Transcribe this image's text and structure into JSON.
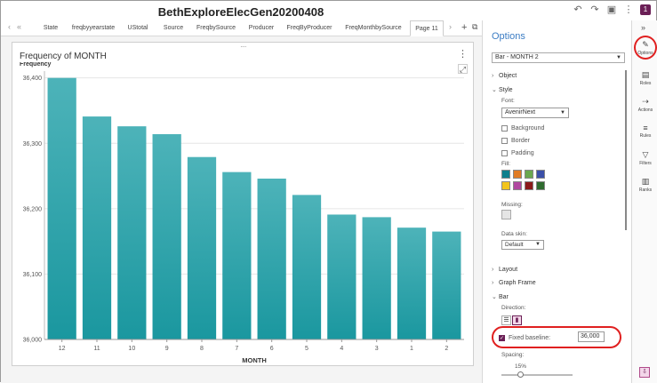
{
  "app": {
    "title": "BethExploreElecGen20200408",
    "badge": "1"
  },
  "tabs": {
    "items": [
      "State",
      "freqbyyearstate",
      "UStotal",
      "Source",
      "FreqbySource",
      "Producer",
      "FreqByProducer",
      "FreqMonthbySource",
      "Page 11"
    ],
    "active_index": 8
  },
  "chart": {
    "title": "Frequency of MONTH"
  },
  "chart_data": {
    "type": "bar",
    "title": "Frequency of MONTH",
    "xlabel": "MONTH",
    "ylabel": "Frequency",
    "categories": [
      "12",
      "11",
      "10",
      "9",
      "8",
      "7",
      "6",
      "5",
      "4",
      "3",
      "1",
      "2"
    ],
    "values": [
      36400,
      36341,
      36326,
      36314,
      36279,
      36256,
      36246,
      36221,
      36191,
      36187,
      36171,
      36165
    ],
    "ylim": [
      36000,
      36405
    ],
    "yticks": [
      36000,
      36100,
      36200,
      36300,
      36400
    ],
    "ytick_labels": [
      "36,000",
      "36,100",
      "36,200",
      "36,300",
      "36,400"
    ],
    "baseline": 36000,
    "grid": true,
    "color": "#2aa4ab"
  },
  "options": {
    "title": "Options",
    "object_select": "Bar - MONTH 2",
    "sections": {
      "object": "Object",
      "style": "Style",
      "layout": "Layout",
      "graph_frame": "Graph Frame",
      "bar": "Bar"
    },
    "font_label": "Font:",
    "font_value": "AvenirNext",
    "checks": [
      "Background",
      "Border",
      "Padding"
    ],
    "fill_label": "Fill:",
    "fill_colors": [
      "#0e7f8c",
      "#e07b24",
      "#6aa84f",
      "#3b4fa8",
      "#f2c41c",
      "#b048a0",
      "#8b1a1a",
      "#2f6b2f"
    ],
    "missing_label": "Missing:",
    "data_skin_label": "Data skin:",
    "data_skin_value": "Default",
    "direction_label": "Direction:",
    "fixed_baseline_label": "Fixed baseline:",
    "fixed_baseline_value": "36,000",
    "spacing_label": "Spacing:",
    "spacing_value": "15%"
  },
  "rail": {
    "items": [
      "Options",
      "Roles",
      "Actions",
      "Rules",
      "Filters",
      "Ranks"
    ]
  }
}
